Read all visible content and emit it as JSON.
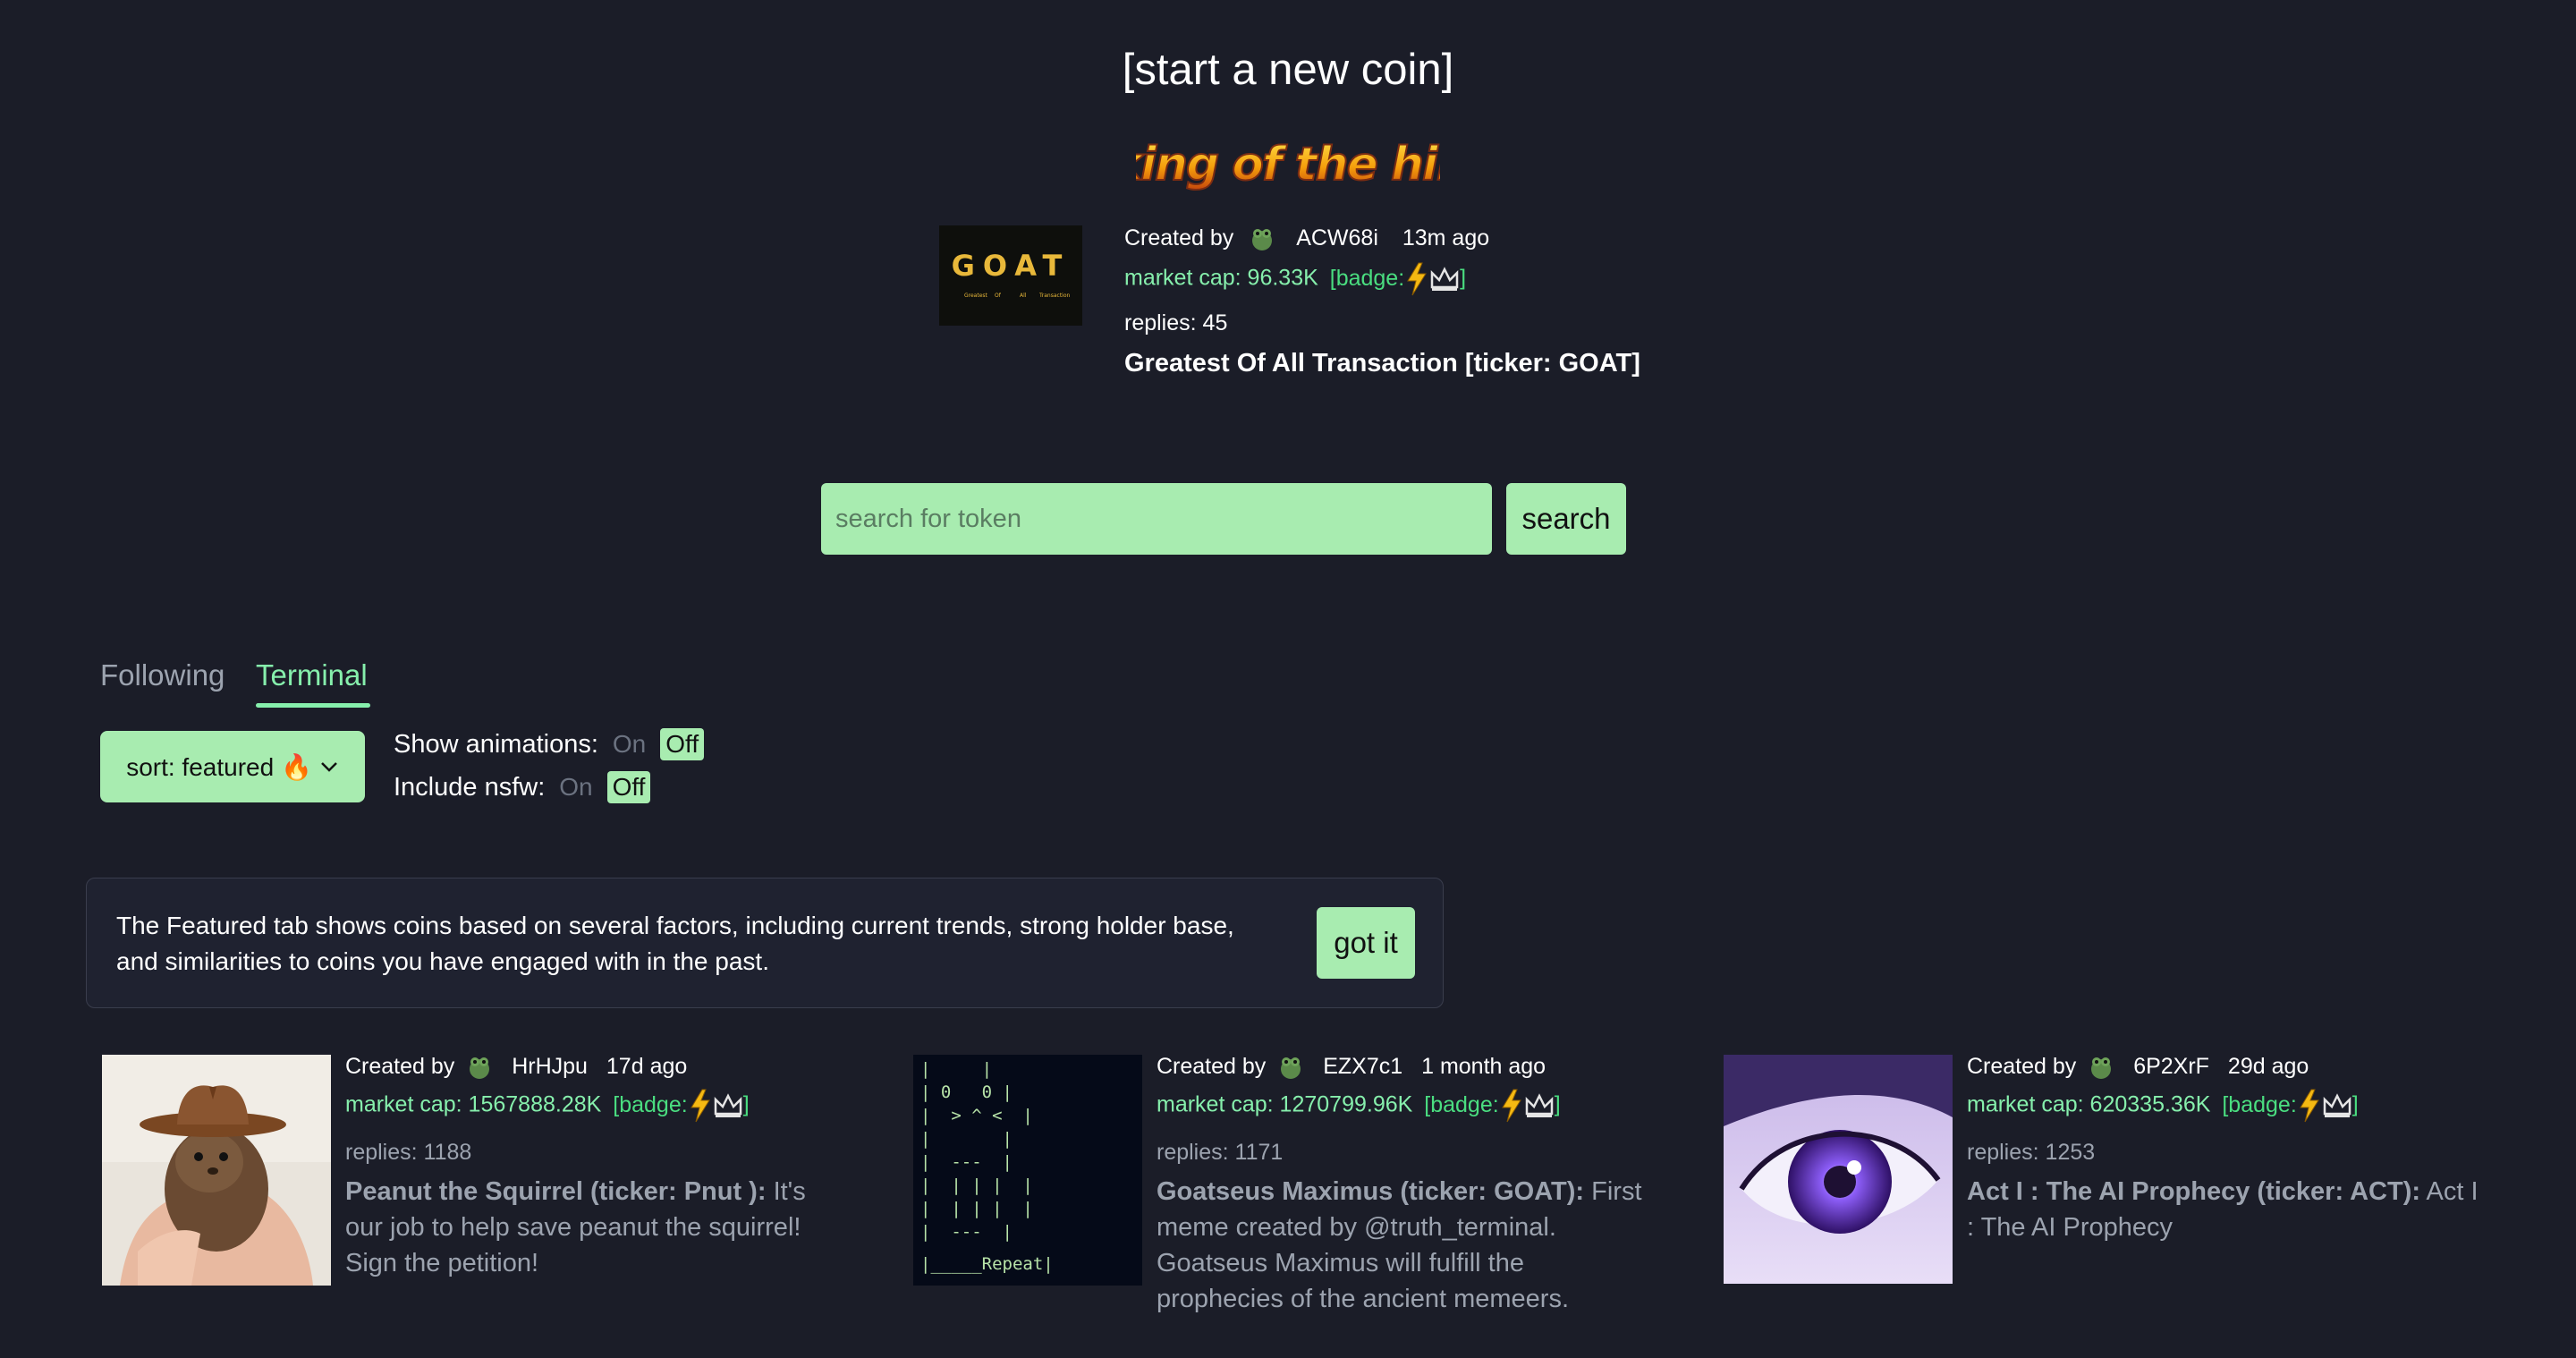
{
  "header": {
    "new_coin_link": "[start a new coin]",
    "king_logo_text": "king of the hill"
  },
  "king": {
    "image_text": "GOAT",
    "image_subtext": [
      "Greatest",
      "Of",
      "All",
      "Transaction"
    ],
    "created_by_label": "Created by",
    "creator": "ACW68i",
    "time_ago": "13m ago",
    "market_cap_label": "market cap: 96.33K",
    "badge_label": "[badge:",
    "badge_close": "]",
    "replies": "replies: 45",
    "title": "Greatest Of All Transaction [ticker: GOAT]"
  },
  "search": {
    "placeholder": "search for token",
    "button_label": "search"
  },
  "tabs": [
    {
      "label": "Following",
      "active": false
    },
    {
      "label": "Terminal",
      "active": true
    }
  ],
  "sort": {
    "label": "sort: featured 🔥"
  },
  "toggles": {
    "animations": {
      "label": "Show animations:",
      "on": "On",
      "off": "Off"
    },
    "nsfw": {
      "label": "Include nsfw:",
      "on": "On",
      "off": "Off"
    }
  },
  "notice": {
    "text": "The Featured tab shows coins based on several factors, including current trends, strong holder base, and similarities to coins you have engaged with in the past.",
    "button_label": "got it"
  },
  "cards": [
    {
      "created_by_label": "Created by",
      "creator": "HrHJpu",
      "time_ago": "17d ago",
      "market_cap": "market cap: 1567888.28K",
      "badge_label": "[badge:",
      "badge_close": "]",
      "replies": "replies: 1188",
      "name": "Peanut the Squirrel (ticker: Pnut ):",
      "description": "It's our job to help save peanut the squirrel! Sign the petition!"
    },
    {
      "created_by_label": "Created by",
      "creator": "EZX7c1",
      "time_ago": "1 month ago",
      "market_cap": "market cap: 1270799.96K",
      "badge_label": "[badge:",
      "badge_close": "]",
      "replies": "replies: 1171",
      "name": "Goatseus Maximus (ticker: GOAT):",
      "description": "First meme created by @truth_terminal. Goatseus Maximus will fulfill the prophecies of the ancient memeers.",
      "ascii_lines": [
        "|     |",
        "| 0   0 |",
        "|  > ^ <  |",
        "|       |",
        "|  ---  |",
        "|  | | |  |",
        "|  | | |  |",
        "|  ---  |",
        "|_____Repeat|"
      ]
    },
    {
      "created_by_label": "Created by",
      "creator": "6P2XrF",
      "time_ago": "29d ago",
      "market_cap": "market cap: 620335.36K",
      "badge_label": "[badge:",
      "badge_close": "]",
      "replies": "replies: 1253",
      "name": "Act I : The AI Prophecy (ticker: ACT):",
      "description": "Act I : The AI Prophecy"
    }
  ]
}
